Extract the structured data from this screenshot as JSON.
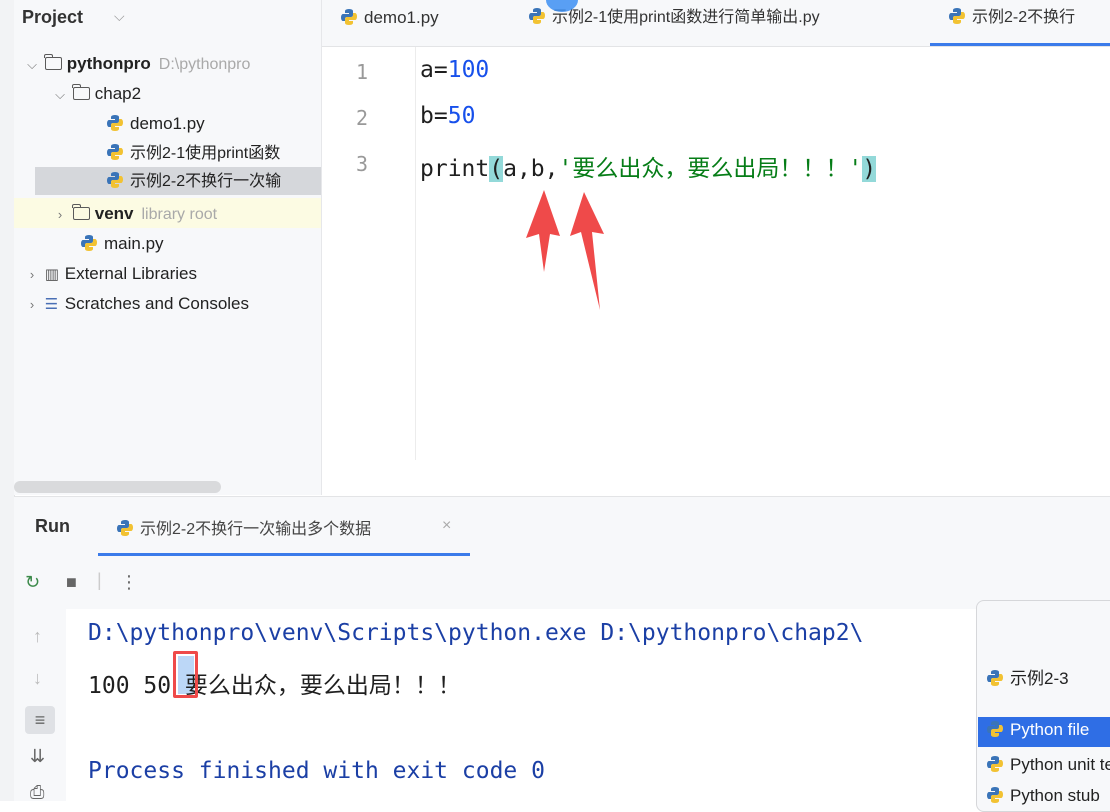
{
  "project_panel": {
    "title": "Project",
    "tree": [
      {
        "label": "pythonpro",
        "hint": "D:\\pythonpro",
        "type": "folder",
        "expanded": true
      },
      {
        "label": "chap2",
        "type": "folder",
        "expanded": true
      },
      {
        "label": "demo1.py",
        "type": "python-file"
      },
      {
        "label": "示例2-1使用print函数",
        "type": "python-file"
      },
      {
        "label": "示例2-2不换行一次输",
        "type": "python-file",
        "selected": true
      },
      {
        "label": "venv",
        "hint": "library root",
        "type": "folder",
        "expanded": false
      },
      {
        "label": "main.py",
        "type": "python-file"
      },
      {
        "label": "External Libraries",
        "type": "library",
        "expanded": false
      },
      {
        "label": "Scratches and Consoles",
        "type": "scratches",
        "expanded": false
      }
    ]
  },
  "editor_tabs": [
    {
      "label": "demo1.py",
      "active": false
    },
    {
      "label": "示例2-1使用print函数进行简单输出.py",
      "active": false
    },
    {
      "label": "示例2-2不换行",
      "active": true
    }
  ],
  "editor": {
    "line_numbers": [
      "1",
      "2",
      "3"
    ],
    "lines": [
      {
        "var": "a",
        "op": "=",
        "value": "100"
      },
      {
        "var": "b",
        "op": "=",
        "value": "50"
      },
      {
        "fn": "print",
        "open": "(",
        "args": "a,b,",
        "string": "'要么出众，要么出局！！！'",
        "close": ")"
      }
    ]
  },
  "run_panel": {
    "label": "Run",
    "tab_label": "示例2-2不换行一次输出多个数据",
    "close": "×",
    "console": {
      "command": "D:\\pythonpro\\venv\\Scripts\\python.exe D:\\pythonpro\\chap2\\",
      "output": "100 50 要么出众，要么出局！！！",
      "exit": "Process finished with exit code 0"
    }
  },
  "popup": {
    "input_value": "示例2-3",
    "items": [
      "Python file",
      "Python unit test",
      "Python stub"
    ]
  },
  "colors": {
    "accent": "#3b7bea",
    "annotation_red": "#ef4a4a",
    "string_green": "#067d17",
    "number_blue": "#1750eb"
  }
}
